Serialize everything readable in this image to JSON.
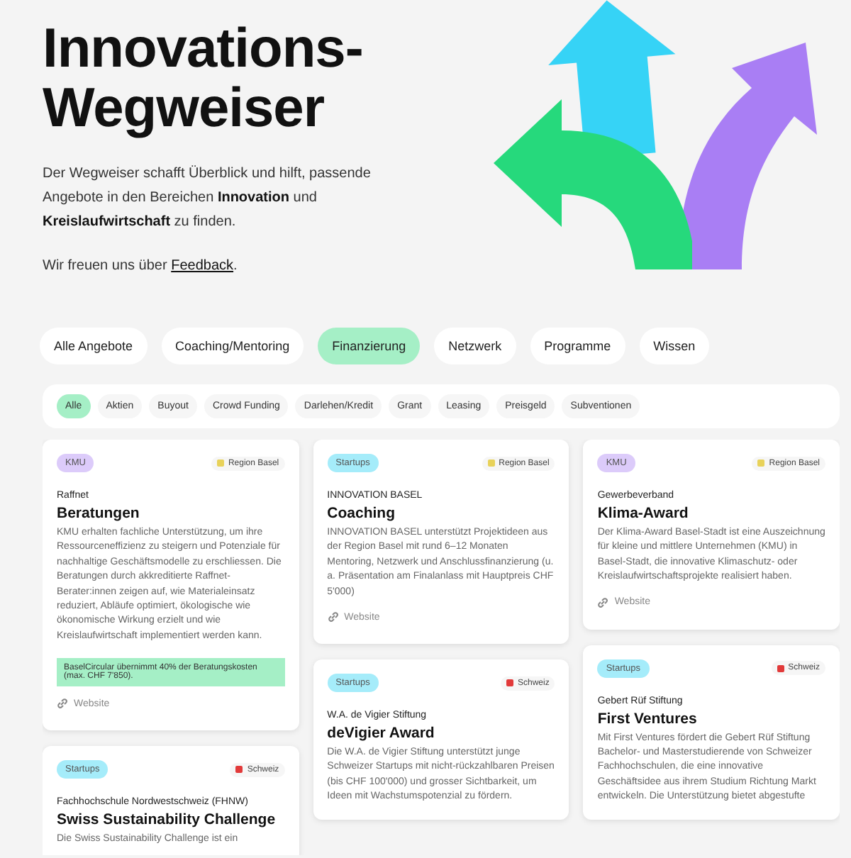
{
  "header": {
    "title_lines": [
      "Innovations-",
      "Wegweiser"
    ],
    "intro": "Der Wegweiser schafft Überblick und hilft, passende Angebote in den Bereichen **Innovation** und **Kreislaufwirtschaft** zu finden.",
    "feedback_prefix": "Wir freuen uns über ",
    "feedback_link": "Feedback",
    "feedback_suffix": "."
  },
  "tabs": [
    {
      "label": "Alle Angebote",
      "selected": false
    },
    {
      "label": "Coaching/Mentoring",
      "selected": false
    },
    {
      "label": "Finanzierung",
      "selected": true
    },
    {
      "label": "Netzwerk",
      "selected": false
    },
    {
      "label": "Programme",
      "selected": false
    },
    {
      "label": "Wissen",
      "selected": false
    }
  ],
  "filters": [
    {
      "label": "Alle",
      "selected": true
    },
    {
      "label": "Aktien",
      "selected": false
    },
    {
      "label": "Buyout",
      "selected": false
    },
    {
      "label": "Crowd Funding",
      "selected": false
    },
    {
      "label": "Darlehen/Kredit",
      "selected": false
    },
    {
      "label": "Grant",
      "selected": false
    },
    {
      "label": "Leasing",
      "selected": false
    },
    {
      "label": "Preisgeld",
      "selected": false
    },
    {
      "label": "Subventionen",
      "selected": false
    }
  ],
  "columns": [
    [
      {
        "tag": {
          "label": "KMU",
          "color": "#dccbfa"
        },
        "region": {
          "label": "Region Basel",
          "color": "#e8d25a"
        },
        "organisation": "Raffnet",
        "title": "Beratungen",
        "description": "KMU erhalten fachliche Unterstützung, um ihre Ressourceneffizienz zu steigern und Potenziale für nachhaltige Geschäftsmodelle zu erschliessen. Die Beratungen durch akkreditierte Raffnet-Berater:innen zeigen auf, wie Materialeinsatz reduziert, Abläufe optimiert, ökologische wie ökonomische Wirkung erzielt und wie Kreislaufwirtschaft implementiert werden kann.",
        "highlight": "BaselCircular übernimmt 40% der Beratungskosten (max. CHF 7'850).",
        "link": "Website"
      },
      {
        "tag": {
          "label": "Startups",
          "color": "#a5ecfa"
        },
        "region": {
          "label": "Schweiz",
          "color": "#e23a3a"
        },
        "organisation": "Fachhochschule Nordwestschweiz (FHNW)",
        "title": "Swiss Sustainability Challenge",
        "description": "Die Swiss Sustainability Challenge ist ein"
      }
    ],
    [
      {
        "tag": {
          "label": "Startups",
          "color": "#a5ecfa"
        },
        "region": {
          "label": "Region Basel",
          "color": "#e8d25a"
        },
        "organisation": "INNOVATION BASEL",
        "title": "Coaching",
        "description": "INNOVATION BASEL unterstützt Projektideen aus der Region Basel mit rund 6–12 Monaten Mentoring, Netzwerk und Anschlussfinanzierung (u. a. Präsentation am Finalanlass mit Hauptpreis CHF 5'000)",
        "link": "Website"
      },
      {
        "tag": {
          "label": "Startups",
          "color": "#a5ecfa"
        },
        "region": {
          "label": "Schweiz",
          "color": "#e23a3a"
        },
        "organisation": "W.A. de Vigier Stiftung",
        "title": "deVigier Award",
        "description": "Die W.A. de Vigier Stiftung unterstützt junge Schweizer Startups mit nicht-rückzahlbaren Preisen (bis CHF 100'000) und grosser Sichtbarkeit, um Ideen mit Wachstumspotenzial zu fördern."
      }
    ],
    [
      {
        "tag": {
          "label": "KMU",
          "color": "#dccbfa"
        },
        "region": {
          "label": "Region Basel",
          "color": "#e8d25a"
        },
        "organisation": "Gewerbeverband",
        "title": "Klima-Award",
        "description": "Der Klima-Award Basel-Stadt ist eine Auszeichnung für kleine und mittlere Unternehmen (KMU) in Basel-Stadt, die innovative Klimaschutz- oder Kreislaufwirtschaftsprojekte realisiert haben.",
        "link": "Website"
      },
      {
        "tag": {
          "label": "Startups",
          "color": "#a5ecfa"
        },
        "region": {
          "label": "Schweiz",
          "color": "#e23a3a"
        },
        "organisation": "Gebert Rüf Stiftung",
        "title": "First Ventures",
        "description": "Mit First Ventures fördert die Gebert Rüf Stiftung Bachelor- und Masterstudierende von Schweizer Fachhochschulen, die eine innovative Geschäftsidee aus ihrem Studium Richtung Markt entwickeln. Die Unterstützung bietet abgestufte"
      }
    ]
  ]
}
